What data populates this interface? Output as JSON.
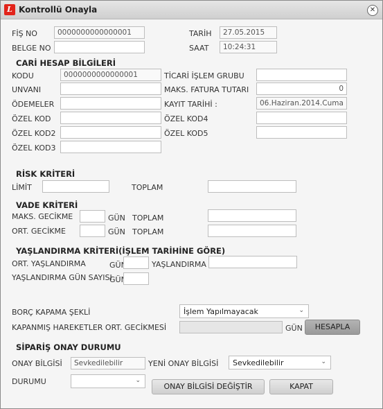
{
  "window": {
    "title": "Kontrollü Onayla",
    "app_icon": "L",
    "close_glyph": "✕"
  },
  "fis": {
    "fis_no_label": "FİŞ NO",
    "fis_no": "0000000000000001",
    "belge_no_label": "BELGE NO",
    "belge_no": "",
    "tarih_label": "TARİH",
    "tarih": "27.05.2015",
    "saat_label": "SAAT",
    "saat": "10:24:31"
  },
  "cari": {
    "section": "CARİ HESAP BİLGİLERİ",
    "kodu_label": "KODU",
    "kodu": "0000000000000001",
    "unvani_label": "UNVANI",
    "unvani": "",
    "odemeler_label": "ÖDEMELER",
    "odemeler": "",
    "ozel_kod_label": "ÖZEL KOD",
    "ozel_kod": "",
    "ozel_kod2_label": "ÖZEL KOD2",
    "ozel_kod2": "",
    "ozel_kod3_label": "ÖZEL KOD3",
    "ozel_kod3": "",
    "ticari_label": "TİCARİ İŞLEM GRUBU",
    "ticari": "",
    "maks_fatura_label": "MAKS. FATURA TUTARI",
    "maks_fatura": "0",
    "kayit_tarihi_label": "KAYIT TARİHİ :",
    "kayit_tarihi": "06.Haziran.2014.Cuma",
    "ozel_kod4_label": "ÖZEL KOD4",
    "ozel_kod4": "",
    "ozel_kod5_label": "ÖZEL KOD5",
    "ozel_kod5": ""
  },
  "risk": {
    "section": "RİSK KRİTERİ",
    "limit_label": "LİMİT",
    "limit": "",
    "toplam_label": "TOPLAM",
    "toplam": ""
  },
  "vade": {
    "section": "VADE KRİTERİ",
    "maks_label": "MAKS. GECİKME",
    "maks": "",
    "gun1": "GÜN",
    "toplam1_label": "TOPLAM",
    "toplam1": "",
    "ort_label": "ORT. GECİKME",
    "ort": "",
    "gun2": "GÜN",
    "toplam2_label": "TOPLAM",
    "toplam2": ""
  },
  "yas": {
    "section": "YAŞLANDIRMA KRİTERİ(İŞLEM TARİHİNE GÖRE)",
    "ort_label": "ORT. YAŞLANDIRMA",
    "gun1": "GÜN",
    "ort": "",
    "yaslandirma_label": "YAŞLANDIRMA",
    "yaslandirma": "",
    "gun_sayisi_label": "YAŞLANDIRMA GÜN SAYISI",
    "gun2": "GÜN",
    "gun_sayisi": ""
  },
  "borc": {
    "kapama_label": "BORÇ KAPAMA ŞEKLİ",
    "kapama_value": "İşlem Yapılmayacak",
    "kapanmis_label": "KAPANMIŞ HAREKETLER ORT. GECİKMESİ",
    "kapanmis": "",
    "gun": "GÜN",
    "hesapla": "HESAPLA"
  },
  "siparis": {
    "section": "SİPARİŞ ONAY DURUMU",
    "onay_label": "ONAY BİLGİSİ",
    "onay": "Sevkedilebilir",
    "yeni_label": "YENİ ONAY BİLGİSİ",
    "yeni_value": "Sevkedilebilir",
    "durum_label": "DURUMU",
    "durum_value": "",
    "degistir": "ONAY BİLGİSİ DEĞİŞTİR",
    "kapat": "KAPAT"
  }
}
